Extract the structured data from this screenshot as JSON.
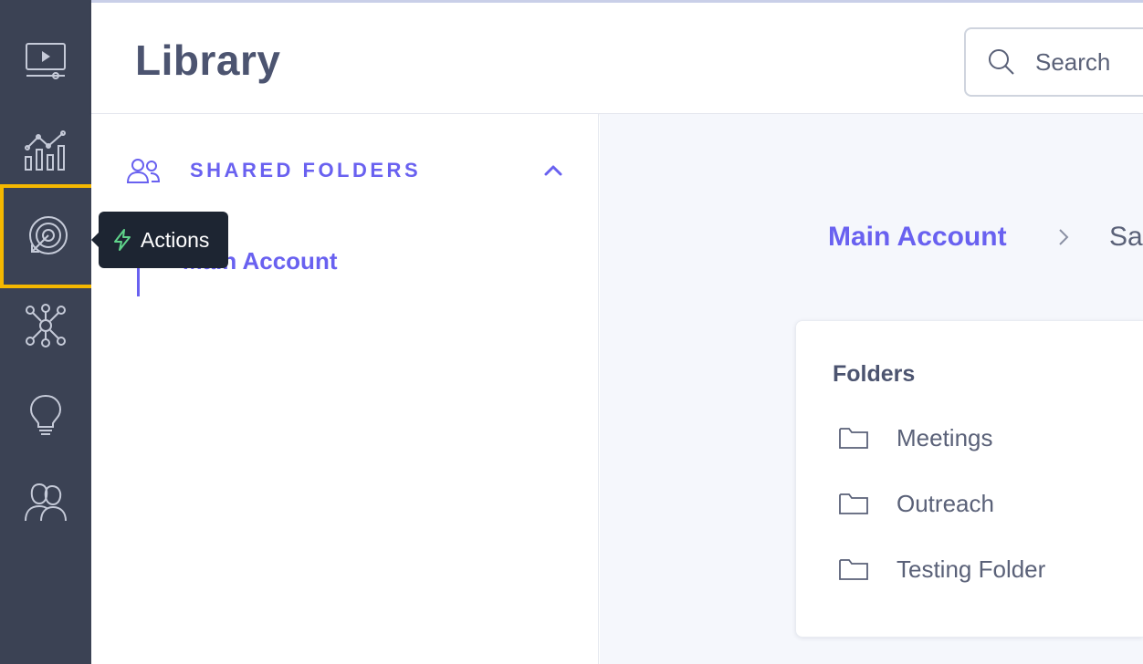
{
  "nav": {
    "items": [
      {
        "id": "videos",
        "icon": "video-player-icon"
      },
      {
        "id": "analytics",
        "icon": "analytics-chart-icon"
      },
      {
        "id": "actions",
        "icon": "actions-target-icon"
      },
      {
        "id": "network",
        "icon": "network-nodes-icon"
      },
      {
        "id": "insights",
        "icon": "lightbulb-icon"
      },
      {
        "id": "team",
        "icon": "people-icon"
      }
    ],
    "tooltip": {
      "label": "Actions",
      "icon": "lightning-icon"
    }
  },
  "header": {
    "title": "Library",
    "search": {
      "placeholder": "Search"
    }
  },
  "sidebar": {
    "section": {
      "title": "SHARED FOLDERS",
      "icon": "people-icon",
      "expanded": true
    },
    "items": [
      {
        "label": "Main Account"
      }
    ]
  },
  "breadcrumb": {
    "items": [
      {
        "label": "Main Account"
      },
      {
        "label": "Sa"
      }
    ]
  },
  "folders": {
    "title": "Folders",
    "items": [
      {
        "label": "Meetings"
      },
      {
        "label": "Outreach"
      },
      {
        "label": "Testing Folder"
      }
    ]
  },
  "colors": {
    "accent": "#6961f0",
    "rail": "#3b4254",
    "highlight": "#f5b800",
    "tooltip": "#1d2532",
    "tooltip_icon": "#5fd38a"
  }
}
